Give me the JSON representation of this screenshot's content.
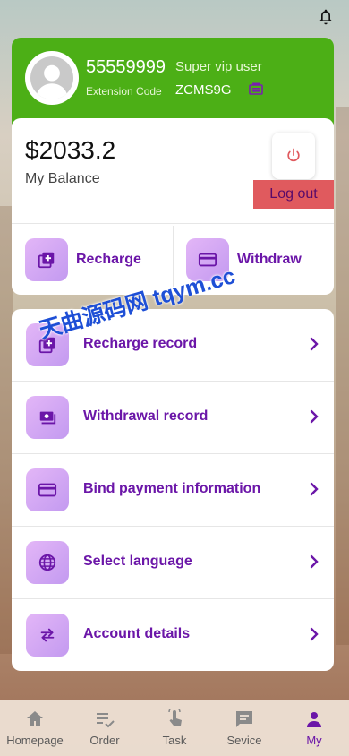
{
  "profile": {
    "user_id": "55559999",
    "vip_level": "Super vip user",
    "extension_label": "Extension Code",
    "extension_code": "ZCMS9G"
  },
  "balance": {
    "amount": "$2033.2",
    "label": "My Balance",
    "logout_label": "Log out"
  },
  "actions": {
    "recharge": "Recharge",
    "withdraw": "Withdraw"
  },
  "menu": [
    {
      "label": "Recharge record",
      "icon": "add-square-icon"
    },
    {
      "label": "Withdrawal record",
      "icon": "cash-icon"
    },
    {
      "label": "Bind payment information",
      "icon": "card-icon"
    },
    {
      "label": "Select language",
      "icon": "globe-icon"
    },
    {
      "label": "Account details",
      "icon": "swap-icon"
    }
  ],
  "watermark": "天曲源码网 tqym.cc",
  "tabs": [
    {
      "label": "Homepage",
      "icon": "home-icon"
    },
    {
      "label": "Order",
      "icon": "order-icon"
    },
    {
      "label": "Task",
      "icon": "task-icon"
    },
    {
      "label": "Sevice",
      "icon": "chat-icon"
    },
    {
      "label": "My",
      "icon": "person-icon"
    }
  ],
  "colors": {
    "profile_bg": "#4caf16",
    "accent": "#6b16a8",
    "logout_bg": "#e05a5e"
  }
}
